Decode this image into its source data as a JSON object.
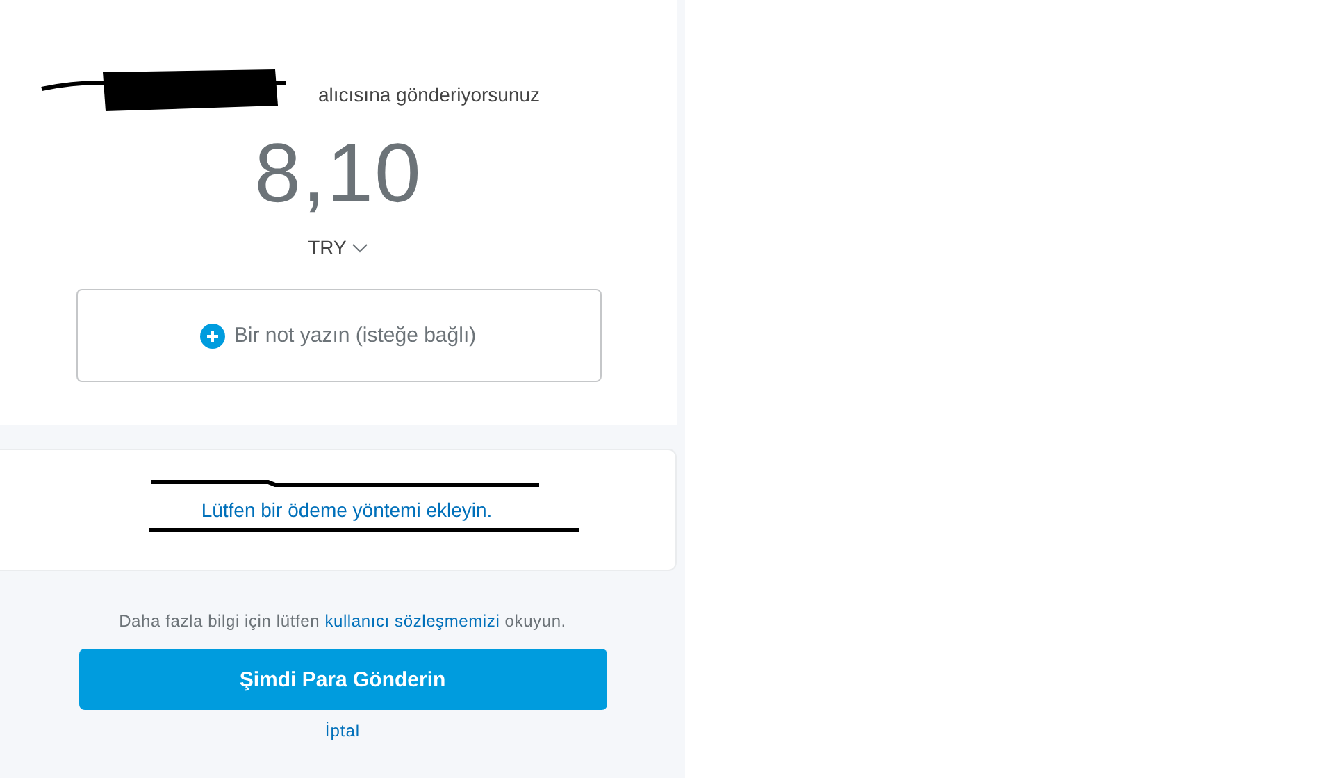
{
  "recipient": {
    "suffix": "alıcısına gönderiyorsunuz"
  },
  "amount": {
    "value": "8,10",
    "currency": "TRY"
  },
  "note": {
    "label": "Bir not yazın (isteğe bağlı)"
  },
  "payment": {
    "link": "Lütfen bir ödeme yöntemi ekleyin."
  },
  "footer": {
    "info_before": "Daha fazla bilgi için lütfen",
    "info_link": "kullanıcı sözleşmemizi",
    "info_after": "okuyun.",
    "send_button": "Şimdi Para Gönderin",
    "cancel": "İptal"
  }
}
